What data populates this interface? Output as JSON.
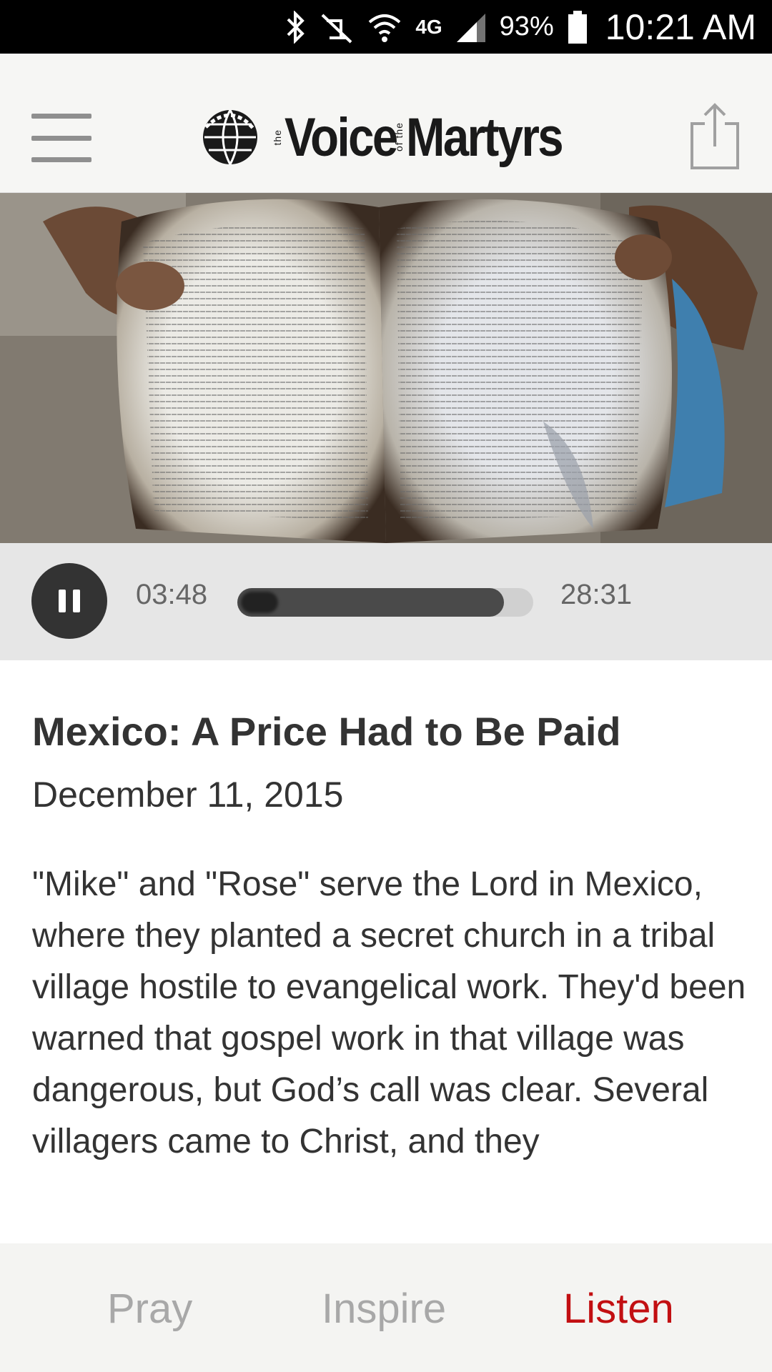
{
  "status_bar": {
    "battery_percent": "93%",
    "time": "10:21 AM",
    "network": "4G",
    "icons": [
      "bluetooth-icon",
      "vibrate-off-icon",
      "wifi-icon",
      "lte-icon",
      "signal-icon",
      "battery-icon"
    ]
  },
  "app_bar": {
    "logo": {
      "the": "the",
      "voice": "Voice",
      "of_the": "of the",
      "martyrs": "Martyrs"
    },
    "icons": [
      "menu-icon",
      "share-icon"
    ]
  },
  "hero_image": {
    "description_icon": "burned-bible-photo"
  },
  "player": {
    "elapsed": "03:48",
    "total": "28:31",
    "progress_fraction": 0.134,
    "buffered_fraction": 0.9,
    "state": "playing"
  },
  "article": {
    "title": "Mexico: A Price Had to Be Paid",
    "date": "December 11, 2015",
    "body": "\"Mike\" and \"Rose\" serve the Lord in Mexico, where they planted a secret church in a tribal village hostile to evangelical work. They'd been warned that gospel work in that village was dangerous, but God’s call was clear. Several villagers came to Christ, and they"
  },
  "bottom_nav": {
    "items": [
      {
        "label": "Pray",
        "active": false
      },
      {
        "label": "Inspire",
        "active": false
      },
      {
        "label": "Listen",
        "active": true
      }
    ]
  },
  "colors": {
    "accent": "#c20f12",
    "inactive_nav": "#a8a8a8",
    "player_bg": "#e6e6e6"
  }
}
